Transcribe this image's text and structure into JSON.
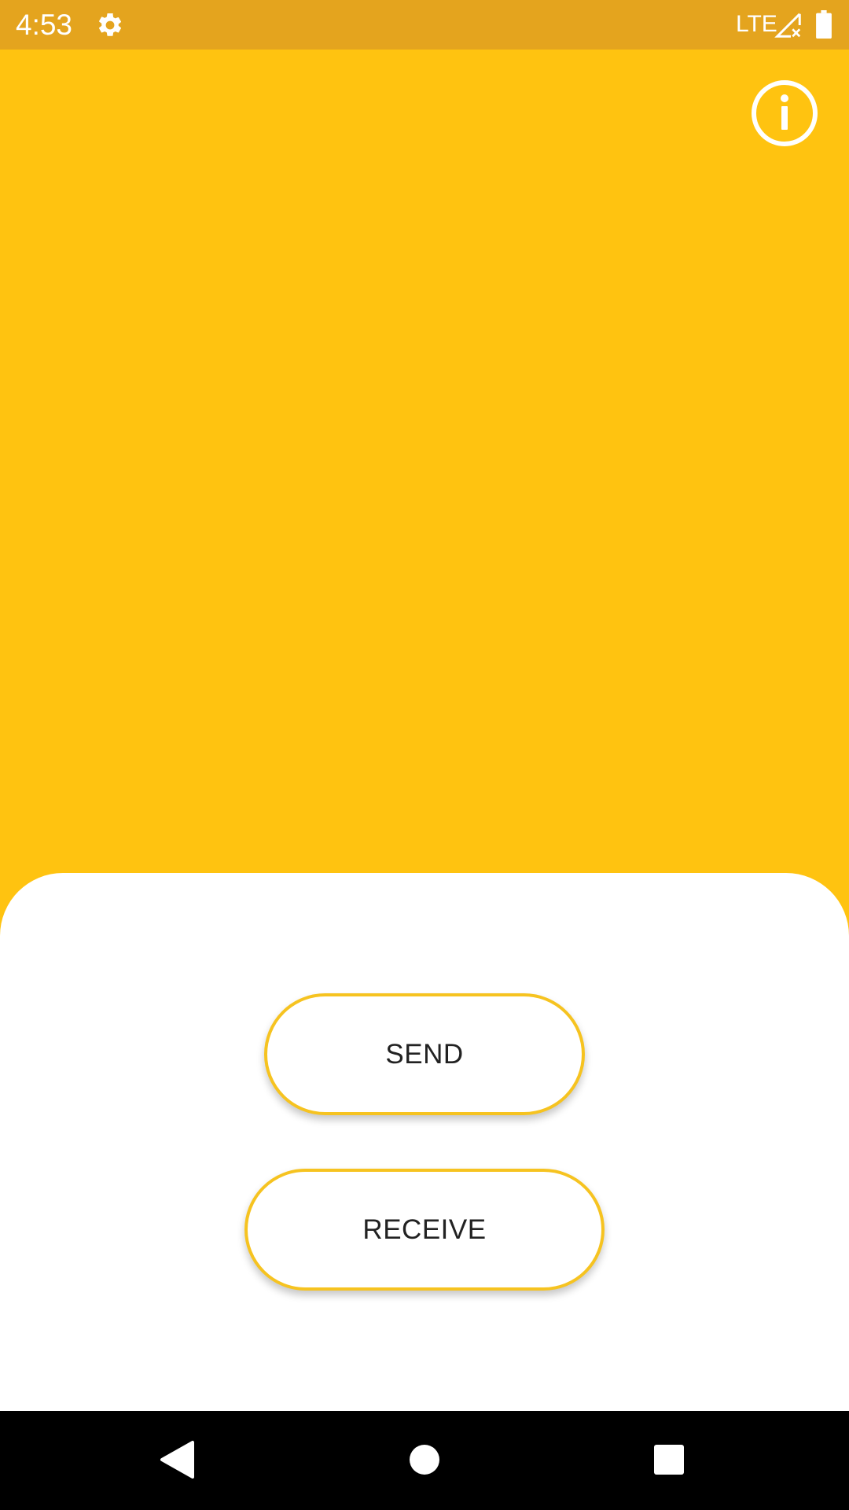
{
  "status_bar": {
    "time": "4:53",
    "network": "LTE",
    "icons": [
      "gear-icon",
      "cell-signal-icon",
      "battery-icon"
    ]
  },
  "header": {
    "info_icon": "info-icon"
  },
  "actions": {
    "send_label": "SEND",
    "receive_label": "RECEIVE"
  },
  "nav_bar": {
    "icons": [
      "back-icon",
      "home-icon",
      "recents-icon"
    ]
  },
  "colors": {
    "background": "#FFC310",
    "status_bar": "#E4A41E",
    "button_border": "#F6C320",
    "button_text": "#222222",
    "sheet": "#FFFFFF",
    "nav_bar": "#000000"
  }
}
